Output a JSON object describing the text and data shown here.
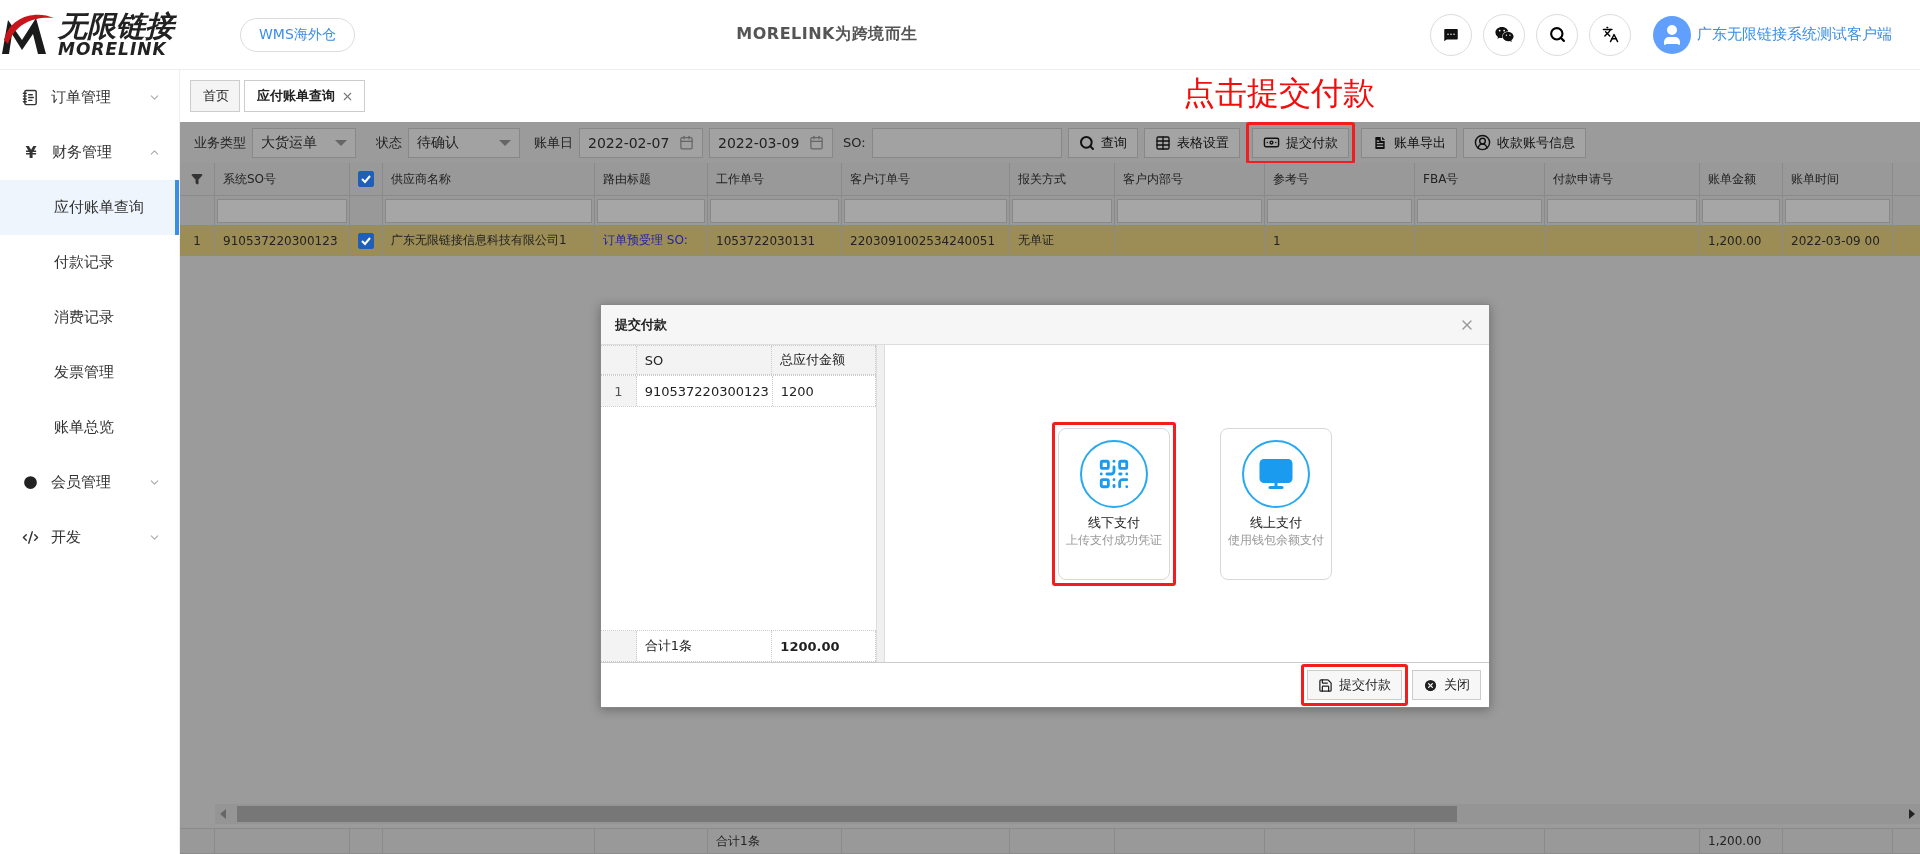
{
  "header": {
    "logo_text": "无限链接",
    "logo_subtext": "MORELINK",
    "warehouse_button": "WMS海外仓",
    "slogan": "MORELINK为跨境而生",
    "user_name": "广东无限链接系统测试客户端"
  },
  "sidebar": {
    "items": [
      {
        "label": "订单管理",
        "expanded": false
      },
      {
        "label": "财务管理",
        "glyph": "¥",
        "expanded": true,
        "children": [
          {
            "label": "应付账单查询",
            "selected": true
          },
          {
            "label": "付款记录",
            "selected": false
          },
          {
            "label": "消费记录",
            "selected": false
          },
          {
            "label": "发票管理",
            "selected": false
          },
          {
            "label": "账单总览",
            "selected": false
          }
        ]
      },
      {
        "label": "会员管理",
        "expanded": false
      },
      {
        "label": "开发",
        "expanded": false
      }
    ]
  },
  "tabs": [
    {
      "label": "首页",
      "selected": false
    },
    {
      "label": "应付账单查询",
      "selected": true
    }
  ],
  "annotation": "点击提交付款",
  "filters": {
    "business_type": {
      "label": "业务类型",
      "value": "大货运单"
    },
    "status": {
      "label": "状态",
      "value": "待确认"
    },
    "bill_date": {
      "label": "账单日",
      "from": "2022-02-07",
      "to": "2022-03-09"
    },
    "so": {
      "label": "SO:"
    }
  },
  "toolbar": [
    {
      "label": "查询",
      "highlighted": false
    },
    {
      "label": "表格设置",
      "highlighted": false
    },
    {
      "label": "提交付款",
      "highlighted": true
    },
    {
      "label": "账单导出",
      "highlighted": false
    },
    {
      "label": "收款账号信息",
      "highlighted": false
    }
  ],
  "table": {
    "header_checked": true,
    "columns": [
      {
        "label": "系统SO号",
        "kind": "text"
      },
      {
        "kind": "checkbox"
      },
      {
        "label": "供应商名称",
        "kind": "text"
      },
      {
        "label": "路由标题",
        "kind": "link"
      },
      {
        "label": "工作单号",
        "kind": "text"
      },
      {
        "label": "客户订单号",
        "kind": "text"
      },
      {
        "label": "报关方式",
        "kind": "text"
      },
      {
        "label": "客户内部号",
        "kind": "text"
      },
      {
        "label": "参考号",
        "kind": "text"
      },
      {
        "label": "FBA号",
        "kind": "text"
      },
      {
        "label": "付款申请号",
        "kind": "text"
      },
      {
        "label": "账单金额",
        "kind": "text"
      },
      {
        "label": "账单时间",
        "kind": "text"
      }
    ],
    "rows": [
      {
        "number": "1",
        "selected": true,
        "checked": true,
        "system_so": "910537220300123",
        "supplier": "广东无限链接信息科技有限公司1",
        "route_title": "订单预受理 SO:",
        "work_no": "1053722030131",
        "customer_order_no": "2203091002534240051",
        "customs_mode": "无单证",
        "reference_no": "1",
        "bill_amount": "1,200.00",
        "bill_time": "2022-03-09 00"
      }
    ],
    "footer": {
      "work_no": "合计1条",
      "bill_amount": "1,200.00"
    }
  },
  "modal": {
    "title": "提交付款",
    "grid": {
      "columns": [
        "SO",
        "总应付金额"
      ],
      "rows": [
        {
          "number": "1",
          "so": "910537220300123",
          "amount": "1200"
        }
      ],
      "footer": {
        "count": "合计1条",
        "total": "1200.00"
      }
    },
    "options": [
      {
        "title": "线下支付",
        "subtitle": "上传支付成功凭证",
        "highlighted": true
      },
      {
        "title": "线上支付",
        "subtitle": "使用钱包余额支付",
        "highlighted": false
      }
    ],
    "buttons": [
      {
        "label": "提交付款",
        "highlighted": true
      },
      {
        "label": "关闭",
        "highlighted": false
      }
    ]
  }
}
